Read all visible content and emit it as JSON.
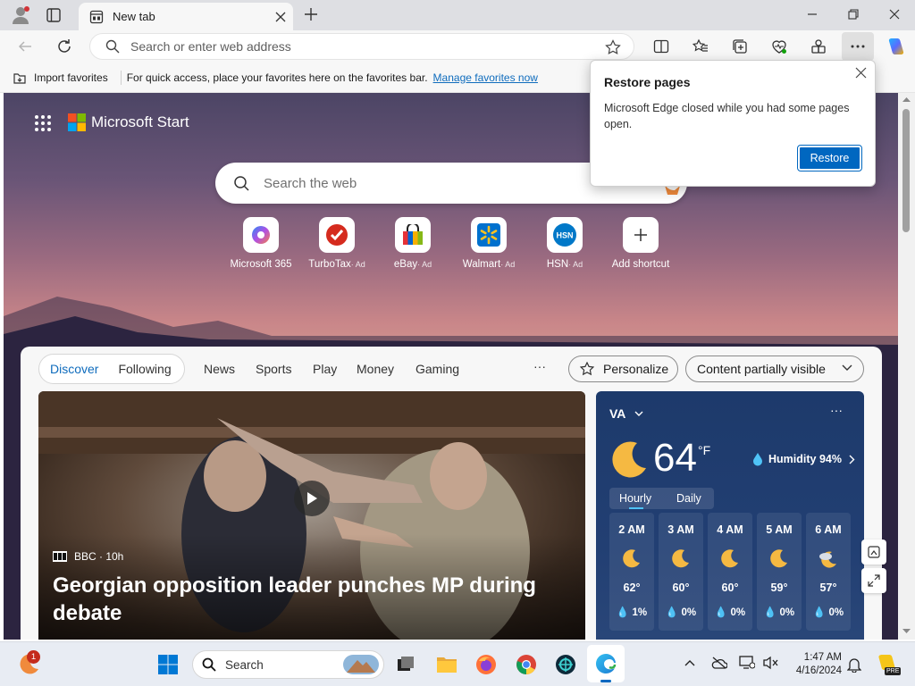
{
  "browser": {
    "tab_title": "New tab",
    "address_placeholder": "Search or enter web address"
  },
  "favorites_bar": {
    "import_label": "Import favorites",
    "message": "For quick access, place your favorites here on the favorites bar.",
    "manage_link": "Manage favorites now"
  },
  "start": {
    "brand": "Microsoft Start",
    "search_placeholder": "Search the web",
    "quick_links": [
      {
        "label": "Microsoft 365",
        "ad": ""
      },
      {
        "label": "TurboTax",
        "ad": "· Ad"
      },
      {
        "label": "eBay",
        "ad": "· Ad"
      },
      {
        "label": "Walmart",
        "ad": "· Ad"
      },
      {
        "label": "HSN",
        "ad": "· Ad"
      },
      {
        "label": "Add shortcut",
        "ad": ""
      }
    ]
  },
  "feed": {
    "tabs": [
      "Discover",
      "Following",
      "News",
      "Sports",
      "Play",
      "Money",
      "Gaming"
    ],
    "more": "···",
    "personalize": "Personalize",
    "content_visibility": "Content partially visible",
    "hero": {
      "source": "BBC · 10h",
      "headline": "Georgian opposition leader punches MP during debate"
    }
  },
  "weather": {
    "location": "VA",
    "temp": "64",
    "unit": "°F",
    "humidity": "Humidity 94%",
    "tabs": [
      "Hourly",
      "Daily"
    ],
    "hourly": [
      {
        "time": "2 AM",
        "temp": "62°",
        "precip": "1%"
      },
      {
        "time": "3 AM",
        "temp": "60°",
        "precip": "0%"
      },
      {
        "time": "4 AM",
        "temp": "60°",
        "precip": "0%"
      },
      {
        "time": "5 AM",
        "temp": "59°",
        "precip": "0%"
      },
      {
        "time": "6 AM",
        "temp": "57°",
        "precip": "0%"
      }
    ],
    "more": "···"
  },
  "restore_popup": {
    "title": "Restore pages",
    "message": "Microsoft Edge closed while you had some pages open.",
    "button": "Restore"
  },
  "taskbar": {
    "search_label": "Search",
    "time": "1:47 AM",
    "date": "4/16/2024",
    "notification_count": "1",
    "pre_badge": "PRE"
  },
  "colors": {
    "accent": "#0f6cbd",
    "restore_button": "#0067c0",
    "weather_bg": "#1d3a6b"
  }
}
